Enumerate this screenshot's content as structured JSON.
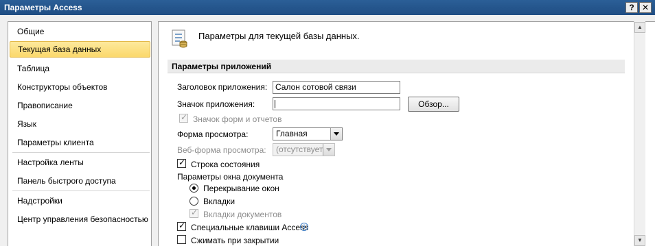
{
  "window": {
    "title": "Параметры Access",
    "help_glyph": "?",
    "close_glyph": "✕"
  },
  "nav": {
    "items": [
      {
        "label": "Общие"
      },
      {
        "label": "Текущая база данных"
      },
      {
        "label": "Таблица"
      },
      {
        "label": "Конструкторы объектов"
      },
      {
        "label": "Правописание"
      },
      {
        "label": "Язык"
      },
      {
        "label": "Параметры клиента"
      },
      {
        "label": "Настройка ленты"
      },
      {
        "label": "Панель быстрого доступа"
      },
      {
        "label": "Надстройки"
      },
      {
        "label": "Центр управления безопасностью"
      }
    ],
    "selected_index": 1
  },
  "header": {
    "text": "Параметры для текущей базы данных."
  },
  "section": {
    "title": "Параметры приложений"
  },
  "form": {
    "app_title_label": "Заголовок приложения:",
    "app_title_value": "Салон сотовой связи",
    "app_icon_label": "Значок приложения:",
    "app_icon_value": "",
    "browse_button": "Обзор...",
    "form_report_icon_label": "Значок форм и отчетов",
    "display_form_label": "Форма просмотра:",
    "display_form_value": "Главная",
    "web_form_label": "Веб-форма просмотра:",
    "web_form_value": "(отсутствует)",
    "status_bar_label": "Строка состояния",
    "doc_window_label": "Параметры окна документа",
    "overlapping_windows_label": "Перекрывание окон",
    "tabbed_docs_label": "Вкладки",
    "doc_tabs_label": "Вкладки документов",
    "access_keys_label": "Специальные клавиши Access",
    "compact_on_close_label": "Сжимать при закрытии"
  },
  "icons": {
    "info": "i",
    "scroll_up": "▲",
    "scroll_down": "▼",
    "check": "✓"
  },
  "colors": {
    "titlebar": "#1f4d83",
    "selected_nav": "#fbd86b"
  }
}
